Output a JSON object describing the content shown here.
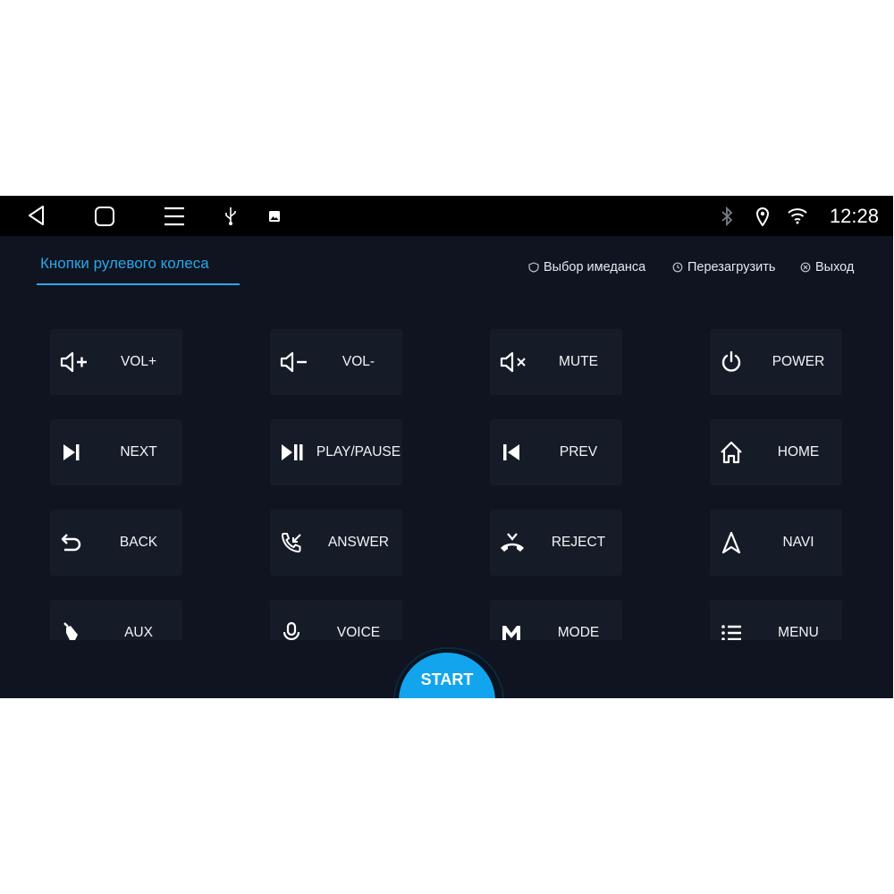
{
  "statusbar": {
    "time": "12:28",
    "icons": [
      "back-nav-icon",
      "home-nav-icon",
      "recent-apps-icon",
      "usb-icon",
      "gallery-icon",
      "bluetooth-icon",
      "location-icon",
      "wifi-icon"
    ]
  },
  "header": {
    "tab_label": "Кнопки рулевого колеса",
    "actions": {
      "impedance": "Выбор имеданса",
      "restart": "Перезагрузить",
      "exit": "Выход"
    }
  },
  "buttons": [
    {
      "label": "VOL+",
      "icon": "volume-up-icon"
    },
    {
      "label": "VOL-",
      "icon": "volume-down-icon"
    },
    {
      "label": "MUTE",
      "icon": "mute-icon"
    },
    {
      "label": "POWER",
      "icon": "power-icon"
    },
    {
      "label": "NEXT",
      "icon": "next-track-icon"
    },
    {
      "label": "PLAY/PAUSE",
      "icon": "play-pause-icon"
    },
    {
      "label": "PREV",
      "icon": "prev-track-icon"
    },
    {
      "label": "HOME",
      "icon": "home-icon"
    },
    {
      "label": "BACK",
      "icon": "back-arrow-icon"
    },
    {
      "label": "ANSWER",
      "icon": "answer-call-icon"
    },
    {
      "label": "REJECT",
      "icon": "reject-call-icon"
    },
    {
      "label": "NAVI",
      "icon": "navigation-icon"
    },
    {
      "label": "AUX",
      "icon": "aux-plug-icon"
    },
    {
      "label": "VOICE",
      "icon": "microphone-icon"
    },
    {
      "label": "MODE",
      "icon": "mode-icon"
    },
    {
      "label": "MENU",
      "icon": "menu-list-icon"
    }
  ],
  "start_button": {
    "label": "START"
  },
  "colors": {
    "accent": "#2aa7e8",
    "start": "#12a5ee",
    "background": "#0f1420",
    "button": "#161c27"
  }
}
